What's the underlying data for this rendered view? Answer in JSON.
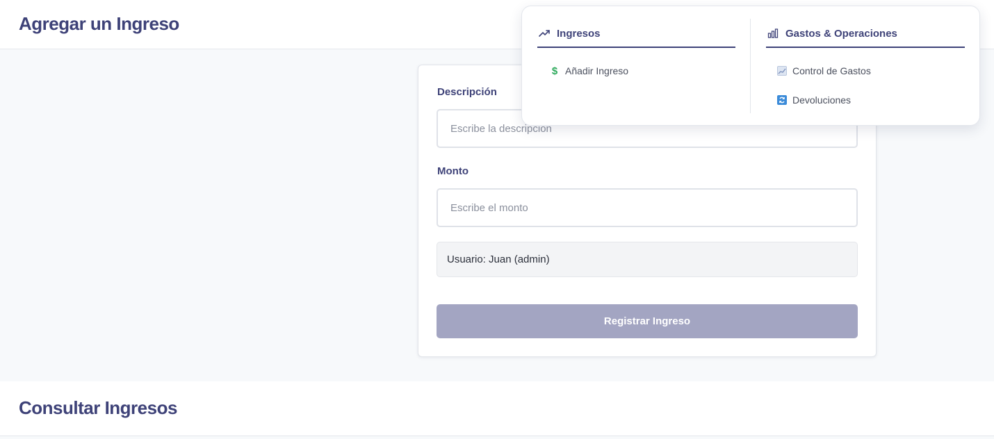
{
  "sections": {
    "add_income": {
      "title": "Agregar un Ingreso"
    },
    "query_income": {
      "title": "Consultar Ingresos"
    }
  },
  "form": {
    "description": {
      "label": "Descripción",
      "placeholder": "Escribe la descripcion",
      "value": ""
    },
    "amount": {
      "label": "Monto",
      "placeholder": "Escribe el monto",
      "value": ""
    },
    "user_text": "Usuario: Juan (admin)",
    "submit_label": "Registrar Ingreso"
  },
  "dropdown": {
    "income_column": {
      "title": "Ingresos",
      "icon": "trending-up-icon",
      "items": [
        {
          "label": "Añadir Ingreso",
          "icon": "dollar-icon",
          "icon_color": "#2eaa5c"
        }
      ]
    },
    "ops_column": {
      "title": "Gastos & Operaciones",
      "icon": "bar-chart-icon",
      "items": [
        {
          "label": "Control de Gastos",
          "icon": "chart-line-icon",
          "icon_color": "#8ea3c8"
        },
        {
          "label": "Devoluciones",
          "icon": "refresh-icon",
          "icon_color": "#3b8bd9"
        }
      ]
    }
  },
  "colors": {
    "accent": "#3e4278",
    "button_disabled": "#a3a5c2",
    "background": "#f7f9fb"
  }
}
